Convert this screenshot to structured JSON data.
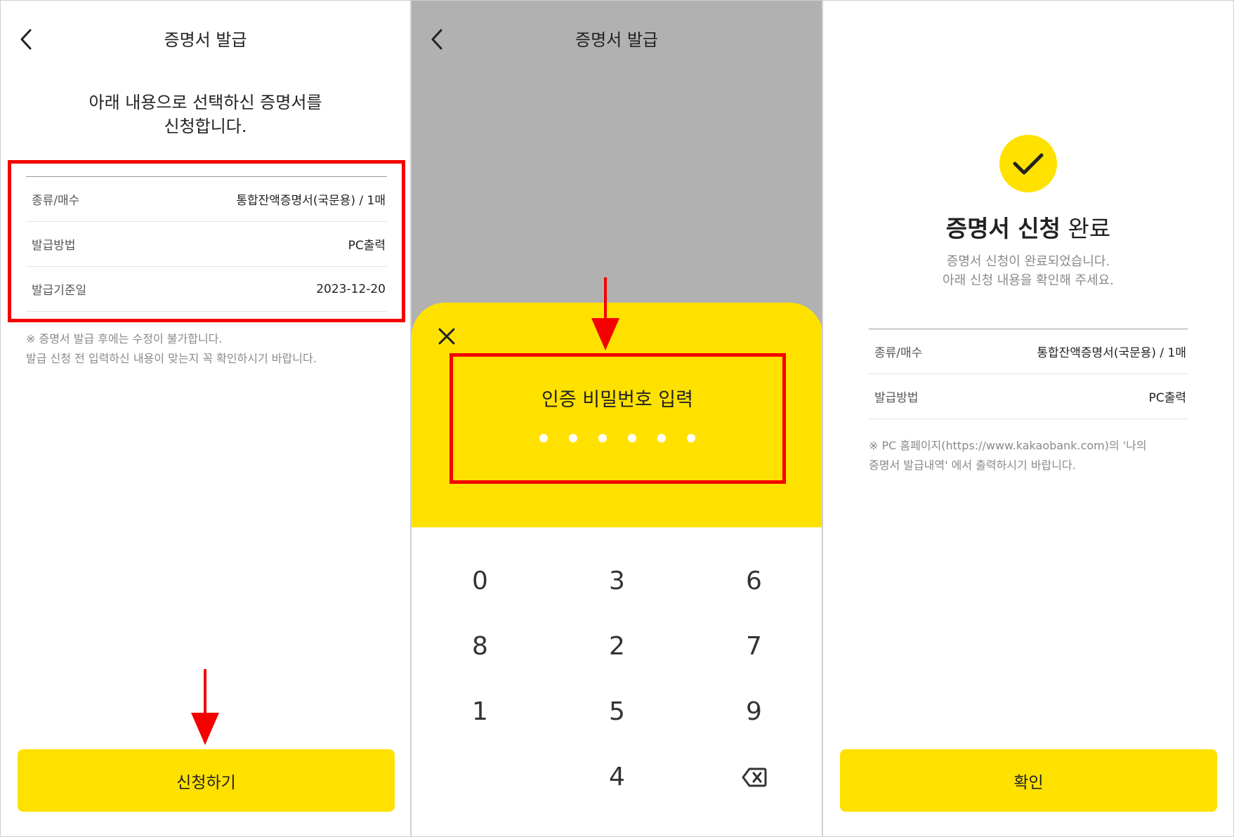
{
  "header": {
    "title": "증명서 발급"
  },
  "apply_screen": {
    "intro_line1": "아래 내용으로 선택하신 증명서를",
    "intro_line2": "신청합니다.",
    "rows": [
      {
        "label": "종류/매수",
        "value": "통합잔액증명서(국문용) / 1매"
      },
      {
        "label": "발급방법",
        "value": "PC출력"
      },
      {
        "label": "발급기준일",
        "value": "2023-12-20"
      }
    ],
    "notice_line1": "※ 증명서 발급 후에는 수정이 불가합니다.",
    "notice_line2": "발급 신청 전 입력하신 내용이 맞는지 꼭 확인하시기 바랍니다.",
    "button_label": "신청하기"
  },
  "pin_screen": {
    "title": "인증 비밀번호 입력",
    "entered_digits": 6,
    "keys": [
      "0",
      "3",
      "6",
      "8",
      "2",
      "7",
      "1",
      "5",
      "9",
      "",
      "4",
      "backspace"
    ]
  },
  "done_screen": {
    "title_bold": "증명서 신청",
    "title_normal": "완료",
    "sub_line1": "증명서 신청이 완료되었습니다.",
    "sub_line2": "아래 신청 내용을 확인해 주세요.",
    "rows": [
      {
        "label": "종류/매수",
        "value": "통합잔액증명서(국문용) / 1매"
      },
      {
        "label": "발급방법",
        "value": "PC출력"
      }
    ],
    "notice_line1": "※ PC 홈페이지(https://www.kakaobank.com)의 '나의",
    "notice_line2": "증명서 발급내역' 에서 출력하시기 바랍니다.",
    "button_label": "확인"
  },
  "colors": {
    "accent_yellow": "#ffe100",
    "highlight_red": "#f40000",
    "dim_overlay": "#b1b1b1"
  }
}
